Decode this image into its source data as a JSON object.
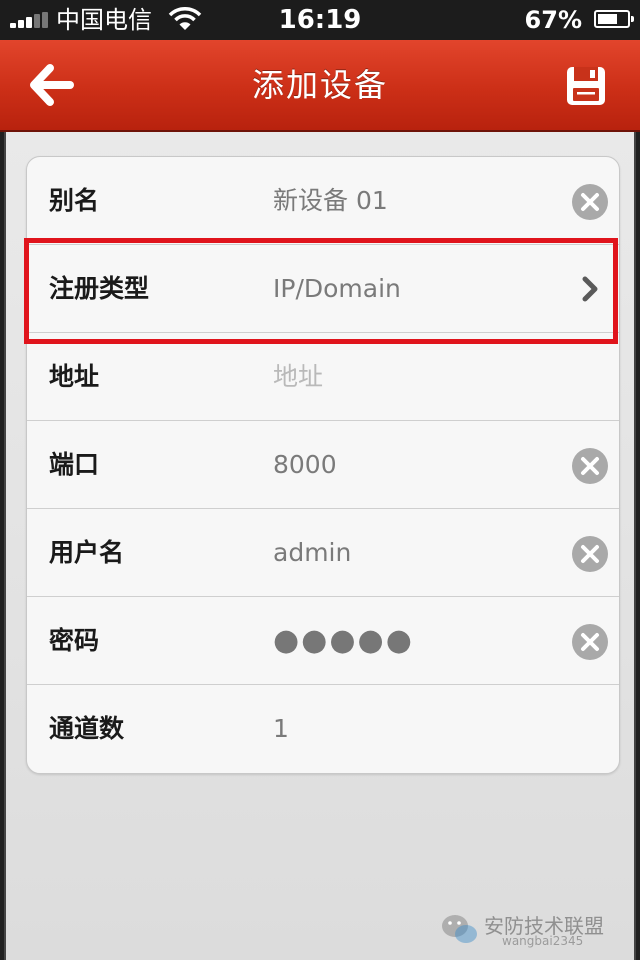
{
  "status_bar": {
    "carrier": "中国电信",
    "time": "16:19",
    "battery_percent_text": "67%",
    "battery_level": 0.67
  },
  "nav_bar": {
    "title": "添加设备",
    "back_icon": "arrow-left-icon",
    "save_icon": "floppy-disk-icon",
    "color": "#cc2f17"
  },
  "form": {
    "rows": [
      {
        "label": "别名",
        "value": "新设备 01",
        "accessory": "clear-icon"
      },
      {
        "label": "注册类型",
        "value": "IP/Domain",
        "accessory": "chevron-right-icon"
      },
      {
        "label": "地址",
        "placeholder": "地址",
        "accessory": ""
      },
      {
        "label": "端口",
        "value": "8000",
        "accessory": "clear-icon"
      },
      {
        "label": "用户名",
        "value": "admin",
        "accessory": "clear-icon"
      },
      {
        "label": "密码",
        "value": "●●●●●",
        "accessory": "clear-icon"
      },
      {
        "label": "通道数",
        "value": "1",
        "accessory": ""
      }
    ]
  },
  "highlight_color": "#e0141c",
  "watermark": {
    "name": "安防技术联盟",
    "id": "wangbai2345",
    "logo_icon": "wechat-logo-icon"
  }
}
